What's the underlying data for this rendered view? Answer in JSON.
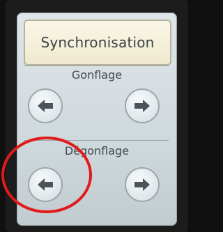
{
  "title": "Synchronisation",
  "sections": {
    "gonflage": {
      "label": "Gonflage"
    },
    "degonflage": {
      "label": "Dégonflage"
    }
  },
  "icons": {
    "left": "arrow-left-icon",
    "right": "arrow-right-icon"
  },
  "colors": {
    "highlight": "#e11a1a",
    "arrow": "#4a545a",
    "title_bg": "#f4efda"
  }
}
